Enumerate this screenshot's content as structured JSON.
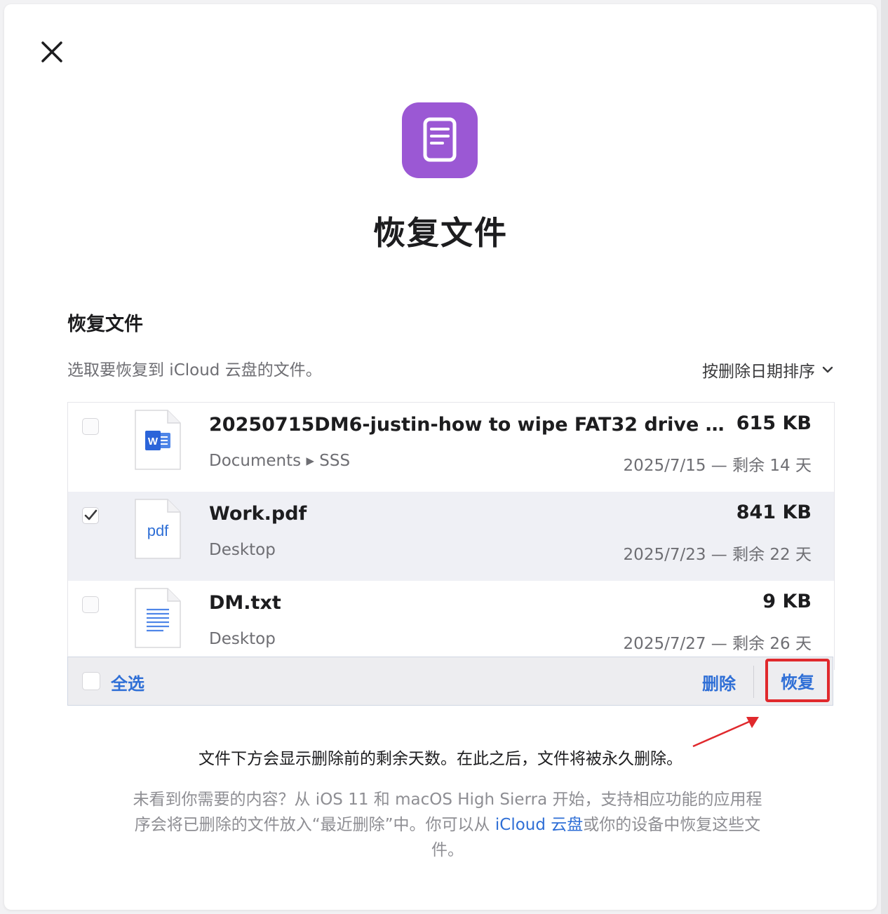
{
  "dialog": {
    "title": "恢复文件",
    "icon": "document-icon",
    "accent_color": "#9b58d4"
  },
  "section": {
    "title": "恢复文件",
    "subtitle": "选取要恢复到 iCloud 云盘的文件。",
    "sort_label": "按删除日期排序"
  },
  "files": [
    {
      "name": "20250715DM6-justin-how to wipe FAT32 drive on ...",
      "size": "615 KB",
      "location": "Documents ▸ SSS",
      "date": "2025/7/15 — 剩余 14 天",
      "type_icon": "word-document-icon",
      "checked": false
    },
    {
      "name": "Work.pdf",
      "size": "841 KB",
      "location": "Desktop",
      "date": "2025/7/23 — 剩余 22 天",
      "type_icon": "pdf-document-icon",
      "type_label": "pdf",
      "checked": true
    },
    {
      "name": "DM.txt",
      "size": "9 KB",
      "location": "Desktop",
      "date": "2025/7/27 — 剩余 26 天",
      "type_icon": "text-document-icon",
      "checked": false
    }
  ],
  "toolbar": {
    "select_all_label": "全选",
    "delete_label": "删除",
    "restore_label": "恢复",
    "link_color": "#2f6fd6",
    "highlight_color": "#e0292d"
  },
  "footer": {
    "notice": "文件下方会显示删除前的剩余天数。在此之后，文件将被永久删除。",
    "help_text_before": "未看到你需要的内容？从 iOS 11 和 macOS High Sierra 开始，支持相应功能的应用程序会将已删除的文件放入“最近删除”中。你可以从 ",
    "help_link": "iCloud 云盘",
    "help_text_after": "或你的设备中恢复这些文件。"
  }
}
